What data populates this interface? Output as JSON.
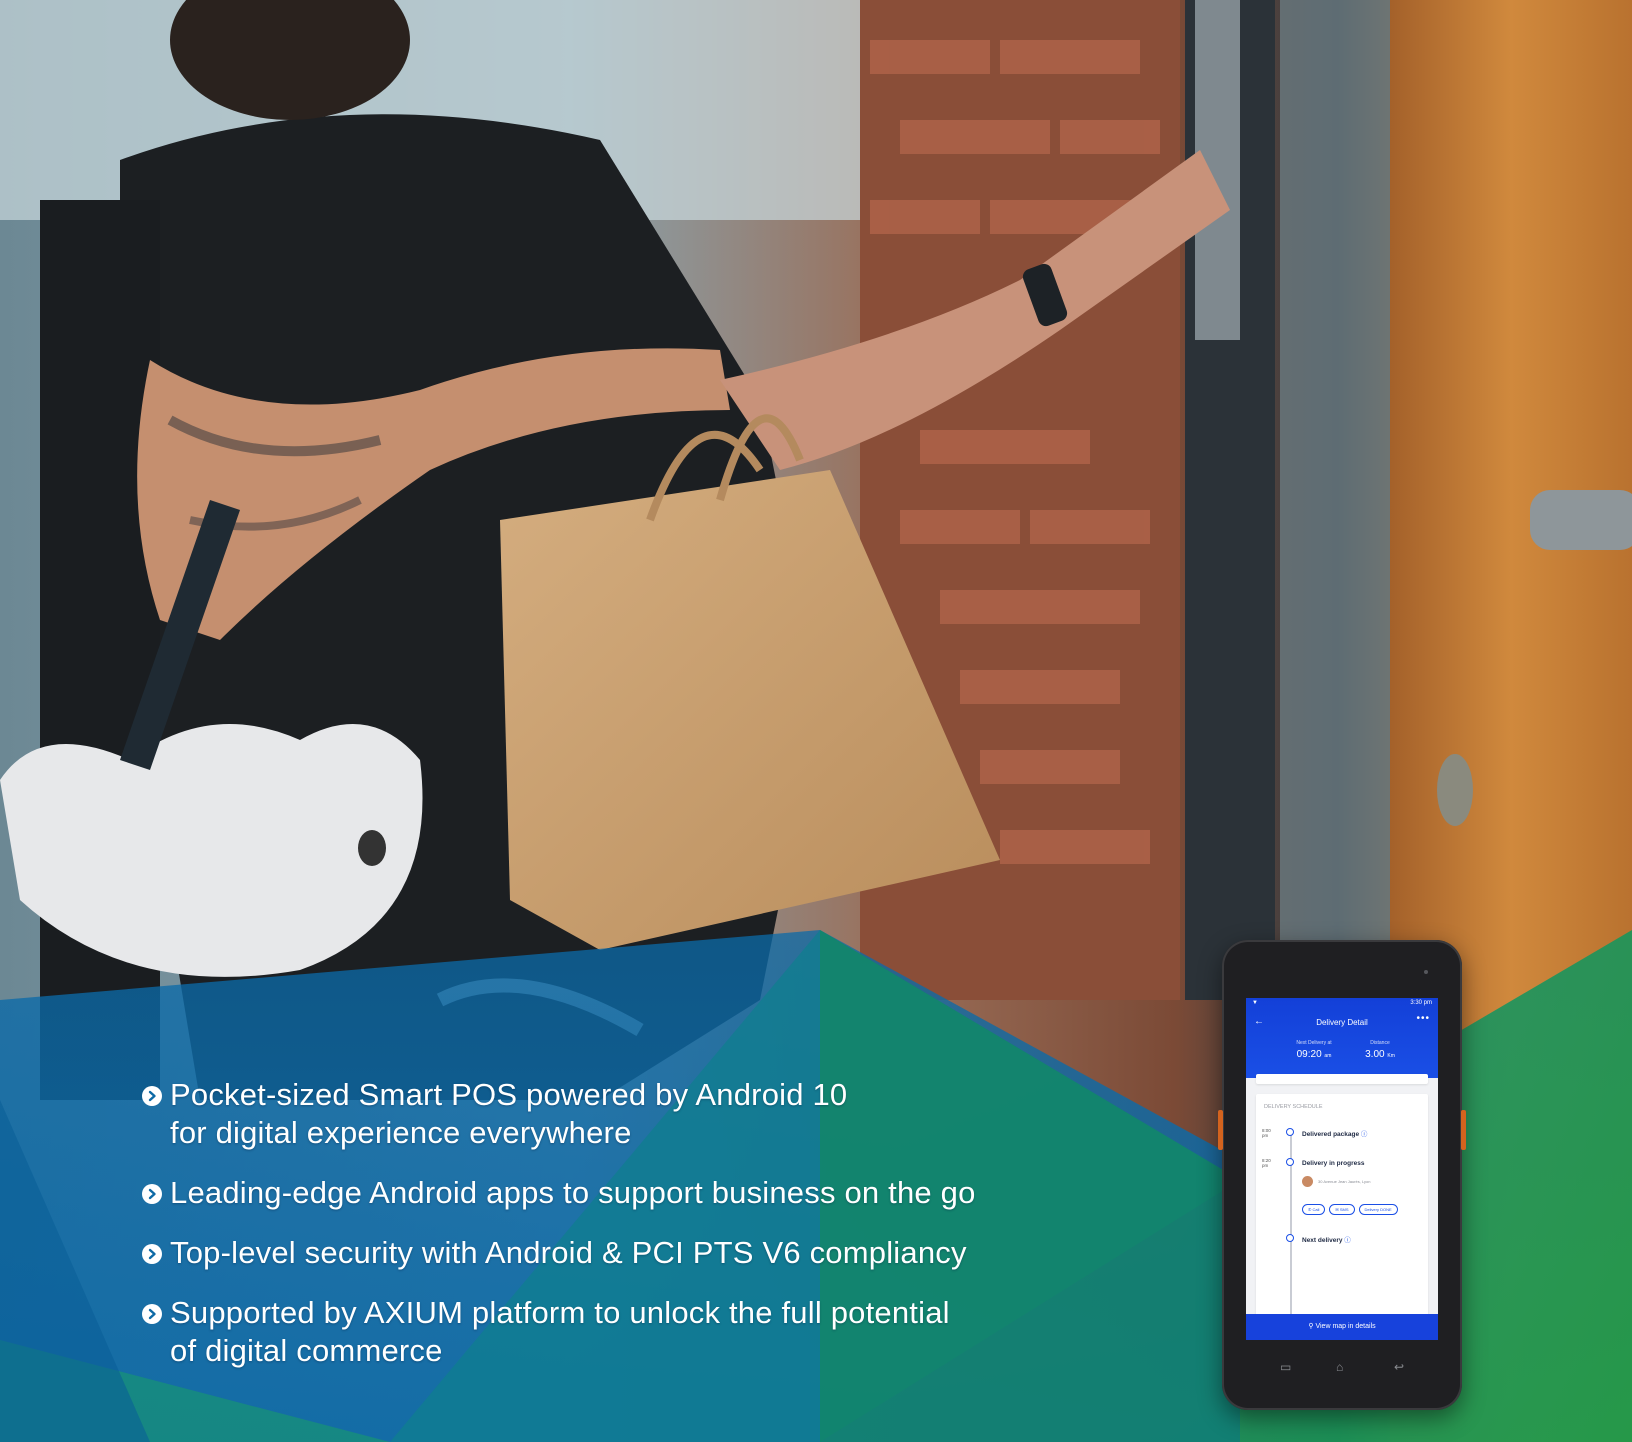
{
  "bullets": [
    {
      "lines": [
        "Pocket-sized Smart POS powered by Android 10",
        "for digital experience everywhere"
      ]
    },
    {
      "lines": [
        "Leading-edge Android apps to support business on the go"
      ]
    },
    {
      "lines": [
        "Top-level security with Android & PCI PTS V6 compliancy"
      ]
    },
    {
      "lines": [
        "Supported by AXIUM platform to unlock the full potential",
        "of digital commerce"
      ]
    }
  ],
  "device": {
    "status_time": "3:30 pm",
    "app_title": "Delivery Detail",
    "next_delivery_label": "Next Delivery at",
    "next_delivery_time": "09:20",
    "next_delivery_unit": "am",
    "distance_label": "Distance",
    "distance_value": "3.00",
    "distance_unit": "Km",
    "schedule_title": "DELIVERY SCHEDULE",
    "items": [
      {
        "time": "8:00",
        "ampm": "pm",
        "label": "Delivered package"
      },
      {
        "time": "8:20",
        "ampm": "pm",
        "label": "Delivery in progress"
      },
      {
        "time": "",
        "ampm": "",
        "label": "Next delivery"
      }
    ],
    "address": "30 Avenue Jean Jaurès, Lyon",
    "chips": [
      "Call",
      "SMS",
      "Delivery DONE"
    ],
    "map_button": "View map in details"
  },
  "colors": {
    "overlay_blue": "#0e6fb0",
    "overlay_green": "#1e9a56",
    "app_blue": "#1a4fe6",
    "bullet_text": "#ffffff"
  },
  "icons": [
    "bullet-chevron-icon",
    "back-arrow-icon",
    "more-icon",
    "info-icon",
    "phone-icon",
    "sms-icon",
    "map-pin-icon",
    "menu-icon",
    "home-icon",
    "return-icon"
  ]
}
